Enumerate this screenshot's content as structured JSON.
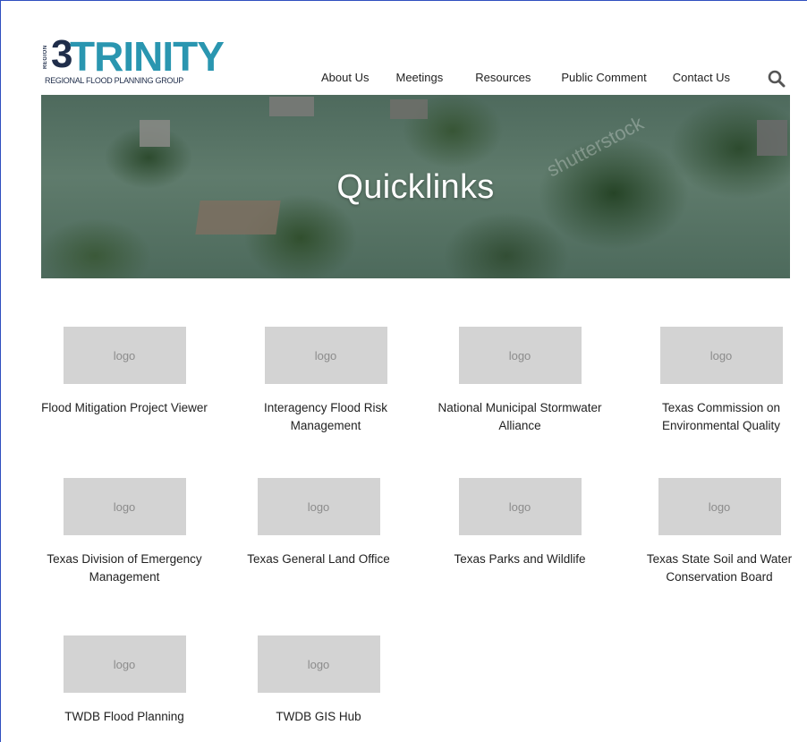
{
  "header": {
    "logo": {
      "region_label": "REGION",
      "region_number": "3",
      "wordmark": "TRINITY",
      "tagline": "REGIONAL FLOOD PLANNING GROUP"
    },
    "nav": [
      "About Us",
      "Meetings",
      "Resources",
      "Public Comment",
      "Contact Us"
    ],
    "search_icon": "search-icon"
  },
  "hero": {
    "title": "Quicklinks",
    "watermark": "shutterstock"
  },
  "quicklinks": [
    {
      "logo_text": "logo",
      "label": "Flood Mitigation Project Viewer"
    },
    {
      "logo_text": "logo",
      "label": "Interagency Flood Risk Management"
    },
    {
      "logo_text": "logo",
      "label": "National Municipal Stormwater Alliance"
    },
    {
      "logo_text": "logo",
      "label": "Texas Commission on Environmental Quality"
    },
    {
      "logo_text": "logo",
      "label": "Texas Division of Emergency Management"
    },
    {
      "logo_text": "logo",
      "label": "Texas General Land Office"
    },
    {
      "logo_text": "logo",
      "label": "Texas Parks and Wildlife"
    },
    {
      "logo_text": "logo",
      "label": "Texas State Soil and Water Conservation Board"
    },
    {
      "logo_text": "logo",
      "label": "TWDB Flood Planning"
    },
    {
      "logo_text": "logo",
      "label": "TWDB GIS Hub"
    }
  ],
  "colors": {
    "brand_teal": "#2a96b0",
    "brand_navy": "#1f2d4a",
    "placeholder_gray": "#d3d3d3"
  }
}
